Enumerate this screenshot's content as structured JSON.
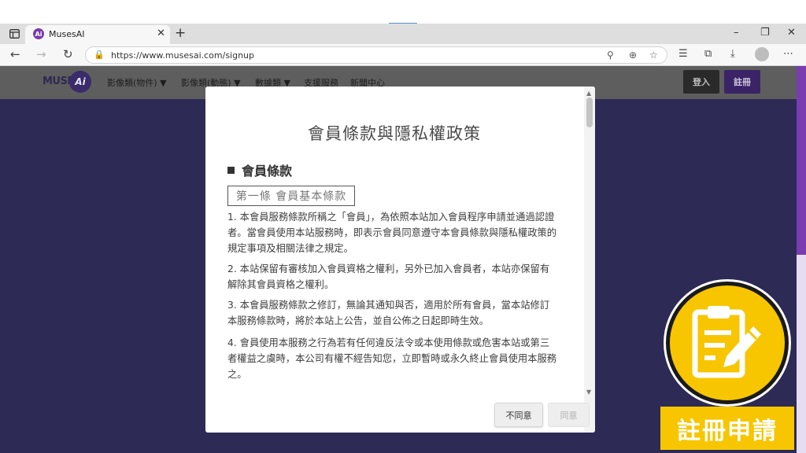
{
  "browser": {
    "tab_title": "MusesAI",
    "url": "https://www.musesai.com/signup",
    "new_tab": "+",
    "window_controls": [
      "–",
      "❐",
      "✕"
    ],
    "icons": [
      "sidebar-toggle-icon",
      "back-icon",
      "forward-icon",
      "refresh-icon",
      "lock-icon",
      "read-aloud-icon",
      "zoom-icon",
      "favorite-add-icon",
      "favorites-icon",
      "collections-icon",
      "downloads-icon",
      "profile-icon",
      "more-icon"
    ]
  },
  "site": {
    "logo_text": "MUSES",
    "logo_ai": "Ai",
    "nav": [
      "影像類(物件) ▼",
      "影像類(動態) ▼",
      "數據類 ▼",
      "支援服務",
      "新聞中心"
    ],
    "login": "登入",
    "register": "註冊"
  },
  "modal": {
    "title": "會員條款與隱私權政策",
    "section": "會員條款",
    "article": "第一條 會員基本條款",
    "paragraphs": [
      "1. 本會員服務條款所稱之「會員」，為依照本站加入會員程序申請並通過認證者。當會員使用本站服務時，即表示會員同意遵守本會員條款與隱私權政策的規定事項及相關法律之規定。",
      "2. 本站保留有審核加入會員資格之權利，另外已加入會員者，本站亦保留有解除其會員資格之權利。",
      "3. 本會員服務條款之修訂，無論其通知與否，適用於所有會員，當本站修訂本服務條款時，將於本站上公告，並自公佈之日起即時生效。",
      "4. 會員使用本服務之行為若有任何違反法令或本使用條款或危害本站或第三者權益之虞時，本公司有權不經告知您，立即暫時或永久終止會員使用本服務之。"
    ],
    "disagree": "不同意",
    "agree": "同意"
  },
  "badge": {
    "label": "註冊申請",
    "icon": "clipboard-edit-icon",
    "color": "#f7c600"
  }
}
